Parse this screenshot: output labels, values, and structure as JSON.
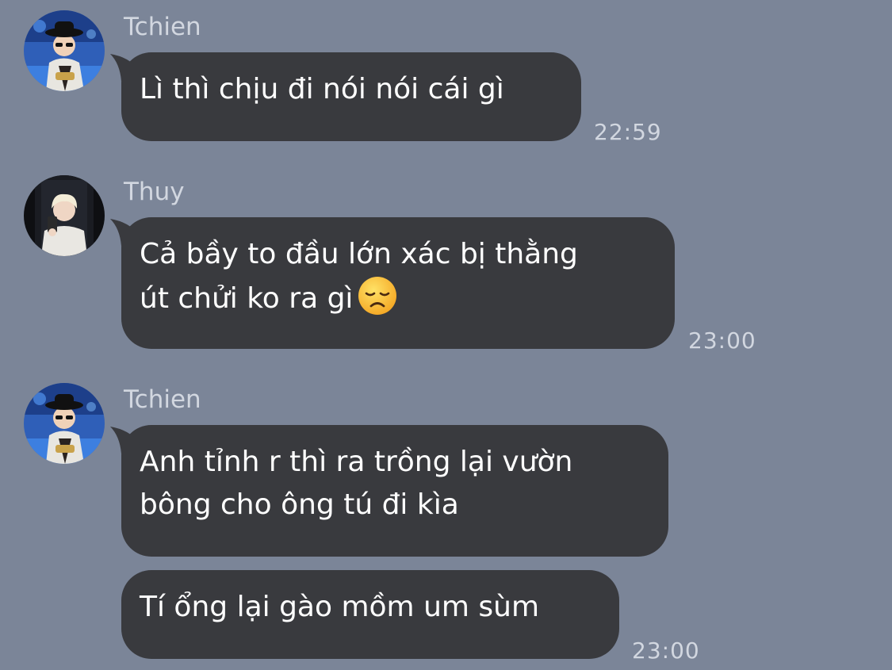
{
  "chat": {
    "messages": [
      {
        "sender": "Tchien",
        "avatar": "tchien-avatar",
        "lines": [
          "Lì thì chịu đi nói nói cái gì"
        ],
        "time": "22:59"
      },
      {
        "sender": "Thuy",
        "avatar": "thuy-avatar",
        "lines": [
          "Cả bầy to đầu lớn xác bị thằng",
          "út chửi ko ra gì"
        ],
        "emoji": "disappointed-face-emoji",
        "time": "23:00"
      },
      {
        "sender": "Tchien",
        "avatar": "tchien-avatar",
        "lines": [
          "Anh tỉnh r thì ra trồng lại vườn",
          "bông cho ông tú đi kìa"
        ]
      },
      {
        "lines": [
          "Tí ổng lại gào mồm um sùm"
        ],
        "time": "23:00"
      }
    ]
  },
  "colors": {
    "background": "#7b8598",
    "bubble": "#393a3e",
    "text": "#ffffff",
    "meta_text": "#d2d7e0"
  }
}
